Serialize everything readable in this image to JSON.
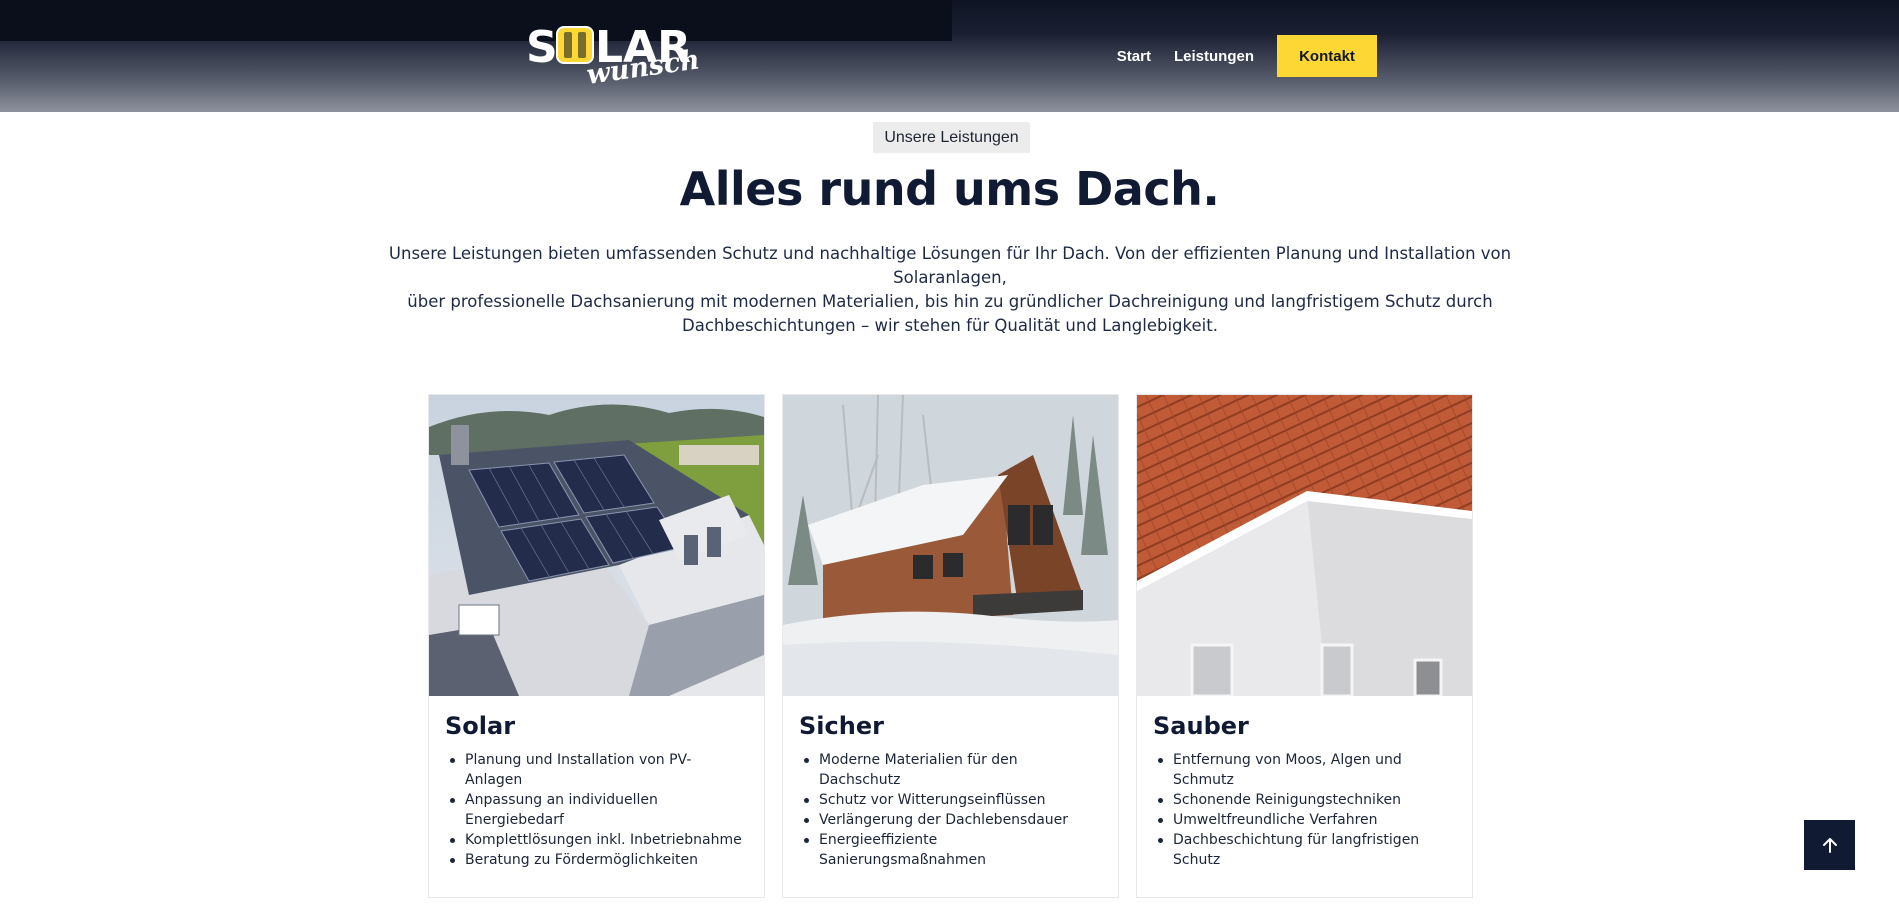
{
  "header": {
    "logo": {
      "main_text": "SOLAR",
      "script_text": "wunsch"
    },
    "nav": [
      {
        "label": "Start"
      },
      {
        "label": "Leistungen"
      }
    ],
    "cta_label": "Kontakt"
  },
  "section": {
    "tag": "Unsere Leistungen",
    "title": "Alles rund ums Dach.",
    "intro_lines": [
      "Unsere Leistungen bieten umfassenden Schutz und nachhaltige Lösungen für Ihr Dach. Von der effizienten Planung und Installation von Solaranlagen,",
      "über professionelle Dachsanierung mit modernen Materialien, bis hin zu gründlicher Dachreinigung und langfristigem Schutz durch",
      "Dachbeschichtungen – wir stehen für Qualität und Langlebigkeit."
    ]
  },
  "cards": [
    {
      "title": "Solar",
      "items": [
        "Planung und Installation von PV-Anlagen",
        "Anpassung an individuellen Energiebedarf",
        "Komplettlösungen inkl. Inbetriebnahme",
        "Beratung zu Fördermöglichkeiten"
      ]
    },
    {
      "title": "Sicher",
      "items": [
        "Moderne Materialien für den Dachschutz",
        "Schutz vor Witterungseinflüssen",
        "Verlängerung der Dachlebensdauer",
        "Energieeffiziente Sanierungsmaßnahmen"
      ]
    },
    {
      "title": "Sauber",
      "items": [
        "Entfernung von Moos, Algen und Schmutz",
        "Schonende Reinigungstechniken",
        "Umweltfreundliche Verfahren",
        "Dachbeschichtung für langfristigen Schutz"
      ]
    }
  ],
  "icons": {
    "back_to_top": "arrow-up-icon"
  },
  "colors": {
    "accent_yellow": "#fdd835",
    "navy": "#111a33"
  }
}
